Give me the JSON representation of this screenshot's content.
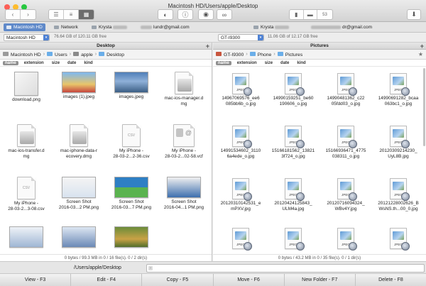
{
  "window": {
    "title": "Macintosh HD/Users/apple/Desktop"
  },
  "toolbar": {
    "back": "‹",
    "forward": "›",
    "drive_count": "53"
  },
  "devices": [
    {
      "label": "Macintosh HD",
      "selected": true
    },
    {
      "label": "Network",
      "selected": false
    },
    {
      "label": "Krysta",
      "selected": false
    },
    {
      "label": "lundr@gmail.com",
      "selected": false
    },
    {
      "label": "Krysta",
      "selected": false
    },
    {
      "label": "dr@gmail.com",
      "selected": false
    }
  ],
  "left": {
    "volume": "Macintosh HD",
    "free": "76.64 GB of 120.11 GB free",
    "title": "Desktop",
    "crumbs": [
      "Macintosh HD",
      "Users",
      "apple",
      "Desktop"
    ],
    "columns": [
      "name",
      "extension",
      "size",
      "date",
      "kind"
    ],
    "files": [
      {
        "name": "download.png",
        "icon": "image"
      },
      {
        "name": "images (1).jpeg",
        "icon": "image"
      },
      {
        "name": "images.jpeg",
        "icon": "image"
      },
      {
        "name": "mac-ios-manager.d\nmg",
        "icon": "dmg"
      },
      {
        "name": "mac-ios-transfer.d\nmg",
        "icon": "dmg"
      },
      {
        "name": "mac-iphone-data-r\necovery.dmg",
        "icon": "dmg"
      },
      {
        "name": "My iPhone -\n28-03-2...2-36.csv",
        "icon": "csv"
      },
      {
        "name": "My iPhone -\n28-03-2...02-58.vcf",
        "icon": "vcard"
      },
      {
        "name": "My iPhone -\n28-03-2...3-08.csv",
        "icon": "csv"
      },
      {
        "name": "Screen Shot\n2016-03...2 PM.png",
        "icon": "image"
      },
      {
        "name": "Screen Shot\n2016-03...7 PM.png",
        "icon": "image"
      },
      {
        "name": "Screen Shot\n2016-04...1 PM.png",
        "icon": "image"
      },
      {
        "name": "",
        "icon": "image"
      },
      {
        "name": "",
        "icon": "image"
      },
      {
        "name": "",
        "icon": "image"
      }
    ],
    "status": "0 bytes / 99.3 MB in 0 / 16 file(s). 0 / 2 dir(s)"
  },
  "right": {
    "volume": "GT-I9300",
    "free": "11.06 GB of 12.17 GB free",
    "title": "Pictures",
    "crumbs": [
      "GT-I9300",
      "Phone",
      "Pictures"
    ],
    "columns": [
      "name",
      "extension",
      "size",
      "date",
      "kind"
    ],
    "files": [
      {
        "name": "14967069576_ee6\n085bb6b_o.jpg"
      },
      {
        "name": "14990159251_be60\n190606_o.jpg"
      },
      {
        "name": "14990481362_c22\n05fdd03_o.jpg"
      },
      {
        "name": "14990691282_bcaa\n063bc1_o.jpg"
      },
      {
        "name": "14991534602_3110\n6a4ede_o.jpg"
      },
      {
        "name": "15166181562_13821\n3f724_o.jpg"
      },
      {
        "name": "15166936471_4775\n038311_o.jpg"
      },
      {
        "name": "20120309214230_\nUyL8B.jpg"
      },
      {
        "name": "20120310142531_e\nmPXV.jpg"
      },
      {
        "name": "20120424125843_\nULM4a.jpg"
      },
      {
        "name": "20120716094324_\nWBv4Y.jpg"
      },
      {
        "name": "20121228002626_B\nWsNS.th...00_0.jpg"
      },
      {
        "name": ""
      },
      {
        "name": ""
      },
      {
        "name": ""
      },
      {
        "name": ""
      }
    ],
    "status": "0 bytes / 43.2 MB in 0 / 35 file(s). 0 / 1 dir(s)"
  },
  "command": {
    "path": "/Users/apple/Desktop",
    "value": ""
  },
  "fkeys": [
    "View - F3",
    "Edit - F4",
    "Copy - F5",
    "Move - F6",
    "New Folder - F7",
    "Delete - F8"
  ]
}
